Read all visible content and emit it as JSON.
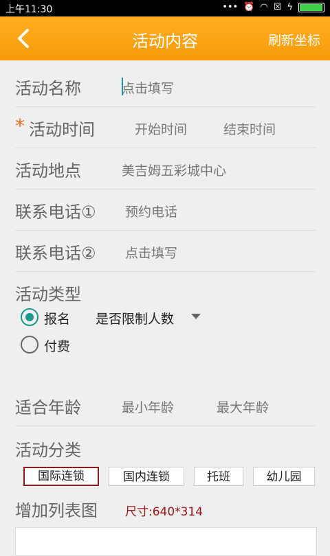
{
  "status": {
    "time": "上午11:30",
    "icons": "•••"
  },
  "appbar": {
    "title": "活动内容",
    "right": "刷新坐标"
  },
  "form": {
    "name": {
      "label": "活动名称",
      "placeholder": "点击填写"
    },
    "time": {
      "required_mark": "*",
      "label": "活动时间",
      "start": "开始时间",
      "end": "结束时间"
    },
    "location": {
      "label": "活动地点",
      "value": "美吉姆五彩城中心"
    },
    "phone1": {
      "label": "联系电话①",
      "placeholder": "预约电话"
    },
    "phone2": {
      "label": "联系电话②",
      "placeholder": "点击填写"
    },
    "type": {
      "label": "活动类型",
      "option1": "报名",
      "option2": "付费",
      "limit": "是否限制人数"
    },
    "age": {
      "label": "适合年龄",
      "min": "最小年龄",
      "max": "最大年龄"
    },
    "category": {
      "label": "活动分类",
      "tags": [
        "国际连锁",
        "国内连锁",
        "托班",
        "幼儿园"
      ]
    },
    "list_image": {
      "label": "增加列表图",
      "size": "尺寸:640*314"
    }
  }
}
